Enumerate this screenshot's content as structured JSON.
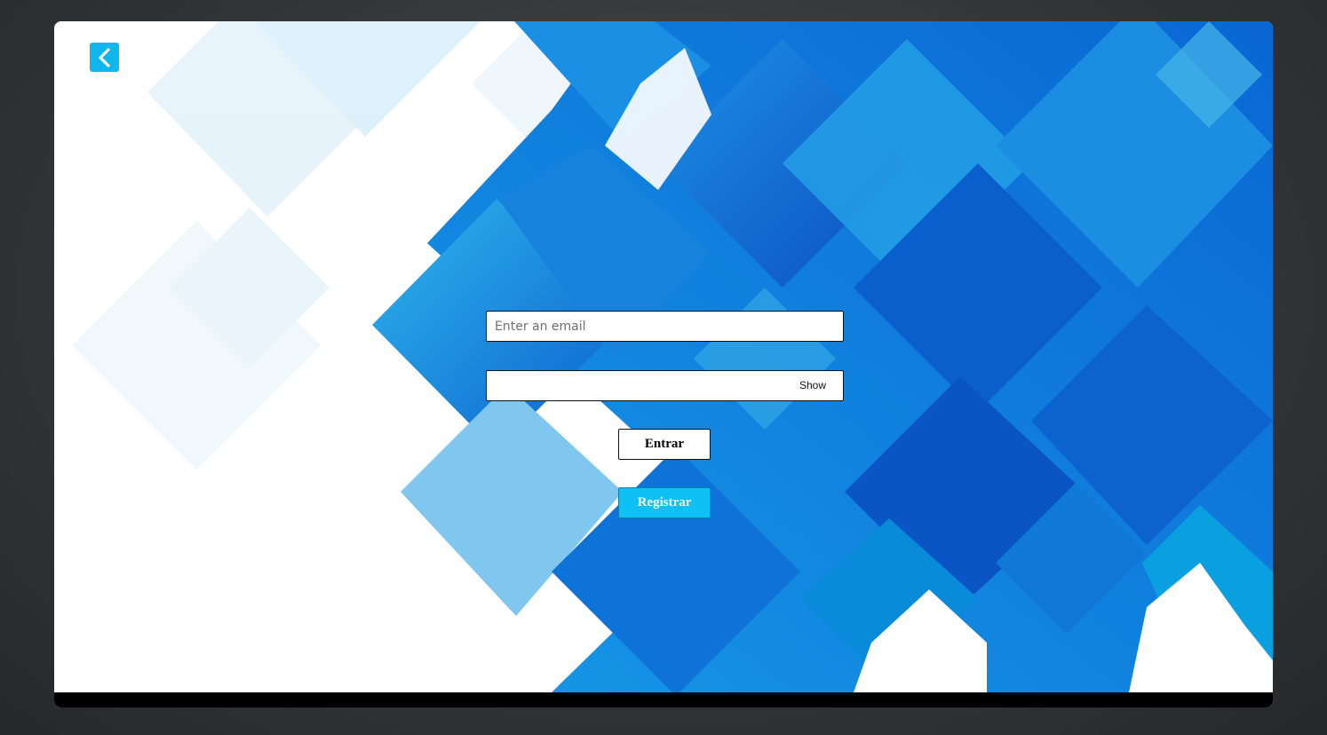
{
  "login": {
    "email_placeholder": "Enter an email",
    "email_value": "",
    "password_value": "",
    "show_label": "Show",
    "login_label": "Entrar",
    "register_label": "Registrar"
  },
  "icons": {
    "back": "chevron-left-icon"
  },
  "colors": {
    "accent": "#0fb8ec",
    "register_button": "#0fc0f4",
    "background_blue": "#0a6fd6",
    "backdrop": "#2f3134"
  }
}
